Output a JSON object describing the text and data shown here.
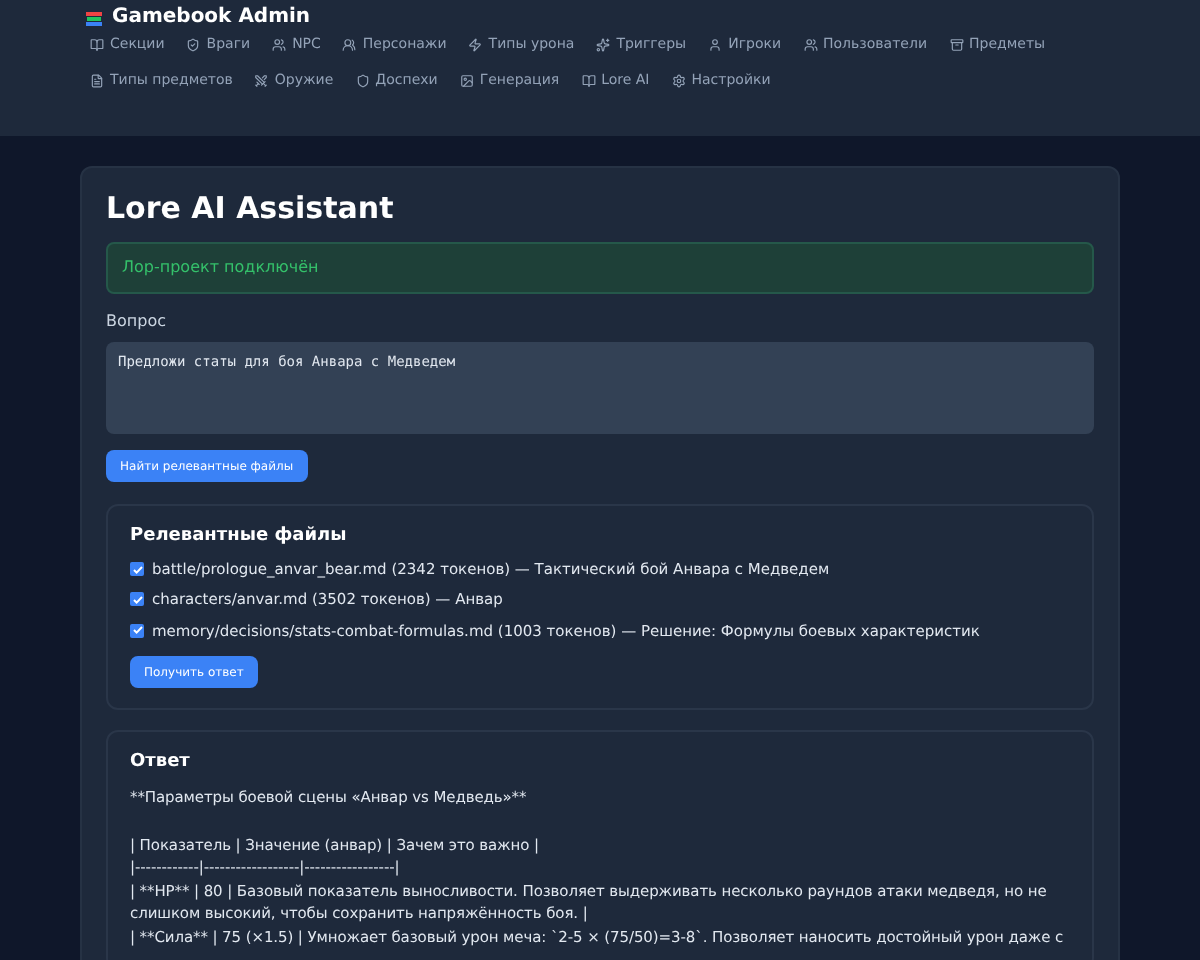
{
  "header": {
    "title": "Gamebook Admin",
    "nav": [
      {
        "label": "Секции"
      },
      {
        "label": "Враги"
      },
      {
        "label": "NPC"
      },
      {
        "label": "Персонажи"
      },
      {
        "label": "Типы урона"
      },
      {
        "label": "Триггеры"
      },
      {
        "label": "Игроки"
      },
      {
        "label": "Пользователи"
      },
      {
        "label": "Предметы"
      },
      {
        "label": "Типы предметов"
      },
      {
        "label": "Оружие"
      },
      {
        "label": "Доспехи"
      },
      {
        "label": "Генерация"
      },
      {
        "label": "Lore AI"
      },
      {
        "label": "Настройки"
      }
    ]
  },
  "page": {
    "title": "Lore AI Assistant",
    "alert": "Лор-проект подключён",
    "question_label": "Вопрос",
    "question_value": "Предложи статы для боя Анвара с Медведем",
    "find_button": "Найти релевантные файлы"
  },
  "files": {
    "title": "Релевантные файлы",
    "items": [
      {
        "label": "battle/prologue_anvar_bear.md (2342 токенов) — Тактический бой Анвара с Медведем",
        "checked": true
      },
      {
        "label": "characters/anvar.md (3502 токенов) — Анвар",
        "checked": true
      },
      {
        "label": "memory/decisions/stats-combat-formulas.md (1003 токенов) — Решение: Формулы боевых характеристик",
        "checked": true
      }
    ],
    "answer_button": "Получить ответ"
  },
  "answer": {
    "title": "Ответ",
    "paragraphs": [
      "**Параметры боевой сцены «Анвар vs Медведь»**",
      "| Показатель | Значение (анвар) | Зачем это важно |\n|------------|------------------|-----------------|\n| **HP** | 80 | Базовый показатель выносливости. Позволяет выдерживать несколько раундов атаки медведя, но не слишком высокий, чтобы сохранить напряжённость боя. |\n| **Сила** | 75 (×1.5) | Умножает базовый урон меча: `2-5 × (75/50)=3-8`. Позволяет наносить достойный урон даже с"
    ]
  }
}
